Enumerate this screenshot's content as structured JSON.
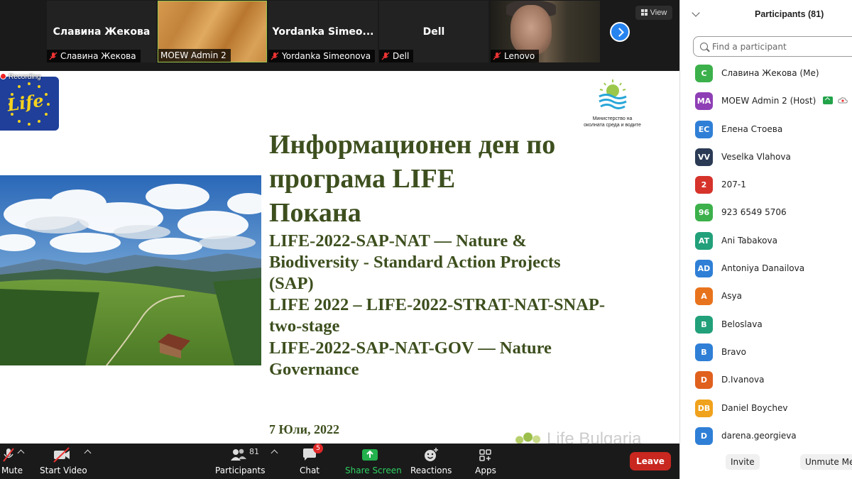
{
  "video_tiles": [
    {
      "big_name": "Славина Жекова",
      "nameplate": "Славина Жекова"
    },
    {
      "big_name": "",
      "nameplate": "MOEW Admin 2"
    },
    {
      "big_name": "Yordanka  Simeo...",
      "nameplate": "Yordanka Simeonova"
    },
    {
      "big_name": "Dell",
      "nameplate": "Dell"
    },
    {
      "big_name": "",
      "nameplate": "Lenovo"
    }
  ],
  "view_label": "View",
  "recording_label": "Recording",
  "slide": {
    "ministry_line1": "Министерство на",
    "ministry_line2": "околната среда и водите",
    "life_logo_text": "Life",
    "title_lines": [
      "Информационен ден по",
      "програма LIFE",
      "Покана"
    ],
    "sub_lines": [
      "LIFE-2022-SAP-NAT — Nature &",
      "Biodiversity - Standard Action Projects",
      "(SAP)",
      "LIFE 2022 – LIFE-2022-STRAT-NAT-SNAP-",
      "two-stage",
      "LIFE-2022-SAP-NAT-GOV — Nature",
      "Governance"
    ],
    "date": "7 Юли, 2022",
    "footer_logo": "Life Bulgaria"
  },
  "toolbar": {
    "mute_label": "Mute",
    "video_label": "Start Video",
    "participants_label": "Participants",
    "participants_count": "81",
    "chat_label": "Chat",
    "chat_badge": "5",
    "share_label": "Share Screen",
    "reactions_label": "Reactions",
    "apps_label": "Apps",
    "leave_label": "Leave"
  },
  "panel": {
    "title": "Participants (81)",
    "search_placeholder": "Find a participant",
    "participants": [
      {
        "initials": "C",
        "name": "Славина Жекова (Me)",
        "color": "#3cb04a"
      },
      {
        "initials": "MA",
        "name": "MOEW Admin 2 (Host)",
        "color": "#8e3fb5"
      },
      {
        "initials": "EC",
        "name": "Елена Стоева",
        "color": "#2f7fd6"
      },
      {
        "initials": "VV",
        "name": "Veselka Vlahova",
        "color": "#2b3a55"
      },
      {
        "initials": "2",
        "name": "207-1",
        "color": "#d6332b"
      },
      {
        "initials": "96",
        "name": "923 6549 5706",
        "color": "#3cb04a"
      },
      {
        "initials": "AT",
        "name": "Ani Tabakova",
        "color": "#22a07a"
      },
      {
        "initials": "AD",
        "name": "Antoniya Danailova",
        "color": "#2f7fd6"
      },
      {
        "initials": "A",
        "name": "Asya",
        "color": "#e8731d"
      },
      {
        "initials": "B",
        "name": "Beloslava",
        "color": "#22a07a"
      },
      {
        "initials": "B",
        "name": "Bravo",
        "color": "#2f7fd6"
      },
      {
        "initials": "D",
        "name": "D.Ivanova",
        "color": "#e0601e"
      },
      {
        "initials": "DB",
        "name": "Daniel Boychev",
        "color": "#f0a21c"
      },
      {
        "initials": "D",
        "name": "darena.georgieva",
        "color": "#2f7fd6"
      }
    ],
    "invite_label": "Invite",
    "unmute_label": "Unmute Me"
  }
}
